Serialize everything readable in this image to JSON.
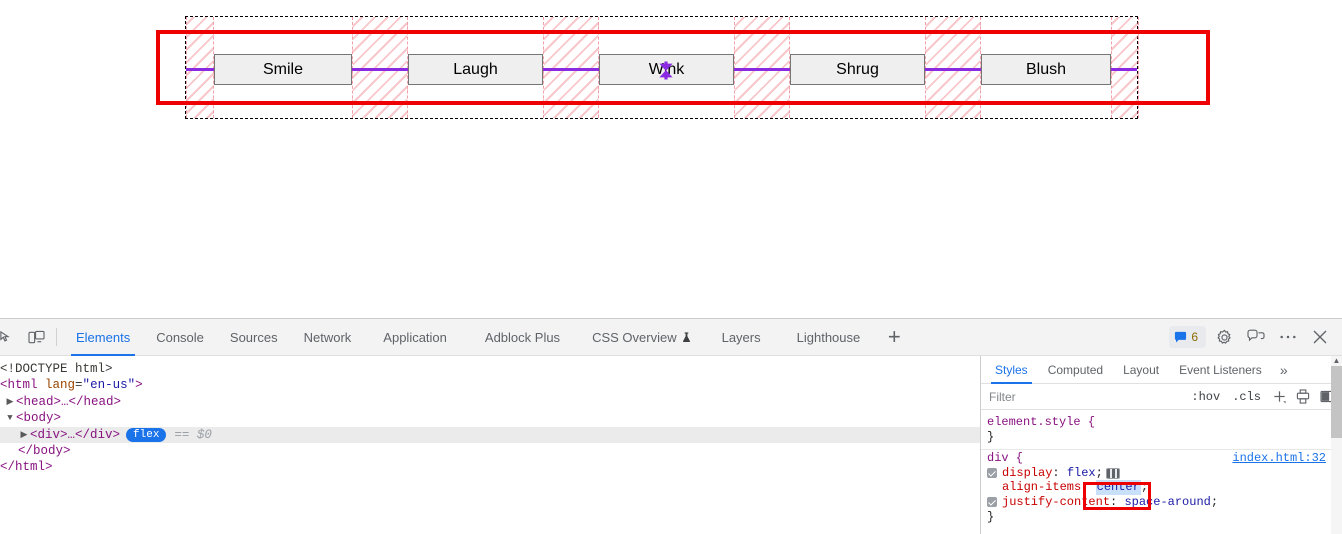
{
  "page": {
    "doctype": "<!DOCTYPE html>",
    "lang": "en-us"
  },
  "viewport": {
    "flex_container": {
      "display": "flex",
      "align_items": "center",
      "justify_content": "space-around",
      "overlay_badge_icon": "align-items-center-icon",
      "align_line_color": "#8a2be2",
      "container_outline_color": "#000000",
      "gap_hatch_color": "#f0a0a8"
    },
    "buttons": [
      {
        "label": "Smile"
      },
      {
        "label": "Laugh"
      },
      {
        "label": "Wink"
      },
      {
        "label": "Shrug"
      },
      {
        "label": "Blush"
      }
    ],
    "annotation": {
      "color": "#ee0000",
      "shape": "rectangle"
    }
  },
  "devtools": {
    "toolbar_left_icons": [
      {
        "name": "inspect-element-icon"
      },
      {
        "name": "device-toolbar-icon"
      }
    ],
    "tabs": [
      {
        "label": "Elements",
        "selected": true
      },
      {
        "label": "Console",
        "selected": false
      },
      {
        "label": "Sources",
        "selected": false
      },
      {
        "label": "Network",
        "selected": false
      },
      {
        "label": "Application",
        "selected": false
      },
      {
        "label": "Adblock Plus",
        "selected": false
      },
      {
        "label": "CSS Overview",
        "selected": false,
        "icon": "experiment-flask-icon"
      },
      {
        "label": "Layers",
        "selected": false
      },
      {
        "label": "Lighthouse",
        "selected": false
      }
    ],
    "add_tab_label": "+",
    "right_controls": {
      "message_count": "6",
      "message_icon": "chat-bubble-icon",
      "settings_icon": "gear-icon",
      "feedback_icon": "feedback-icon",
      "more_icon": "kebab-menu-icon",
      "close_icon": "close-icon",
      "accent": "#1a73e8"
    },
    "dom_tree": [
      {
        "id": "doctype",
        "text": "<!DOCTYPE html>"
      },
      {
        "id": "html_open",
        "text": "<html lang=\"en-us\">"
      },
      {
        "id": "head",
        "text": "<head>…</head>"
      },
      {
        "id": "body_open",
        "text": "<body>"
      },
      {
        "id": "div_selected",
        "text": "<div>…</div>",
        "badge": "flex",
        "marker": "== $0"
      },
      {
        "id": "body_close",
        "text": "</body>"
      },
      {
        "id": "html_close",
        "text": "</html>"
      }
    ],
    "styles": {
      "tabs": [
        {
          "label": "Styles",
          "selected": true
        },
        {
          "label": "Computed",
          "selected": false
        },
        {
          "label": "Layout",
          "selected": false
        },
        {
          "label": "Event Listeners",
          "selected": false
        }
      ],
      "more_tabs_icon": "chevron-double-right-icon",
      "toolbar": {
        "filter_placeholder": "Filter",
        "filter_value": "",
        "hov_label": ":hov",
        "cls_label": ".cls",
        "new_rule_icon": "plus-icon",
        "print_icon": "print-media-icon",
        "sidebar_toggle_icon": "toggle-sidebar-icon"
      },
      "rules": [
        {
          "selector": "element.style {",
          "source": "",
          "declarations": [],
          "close": "}"
        },
        {
          "selector": "div {",
          "source": "index.html:32",
          "declarations": [
            {
              "checkbox": true,
              "property": "display",
              "value": "flex",
              "swatch": "flex-editor-icon",
              "selected": false
            },
            {
              "checkbox": false,
              "property": "align-items",
              "value": "center",
              "swatch": "",
              "selected": true
            },
            {
              "checkbox": true,
              "property": "justify-content",
              "value": "space-around",
              "swatch": "",
              "selected": false
            }
          ],
          "close": "}"
        }
      ],
      "annotation_color": "#ee0000"
    }
  }
}
